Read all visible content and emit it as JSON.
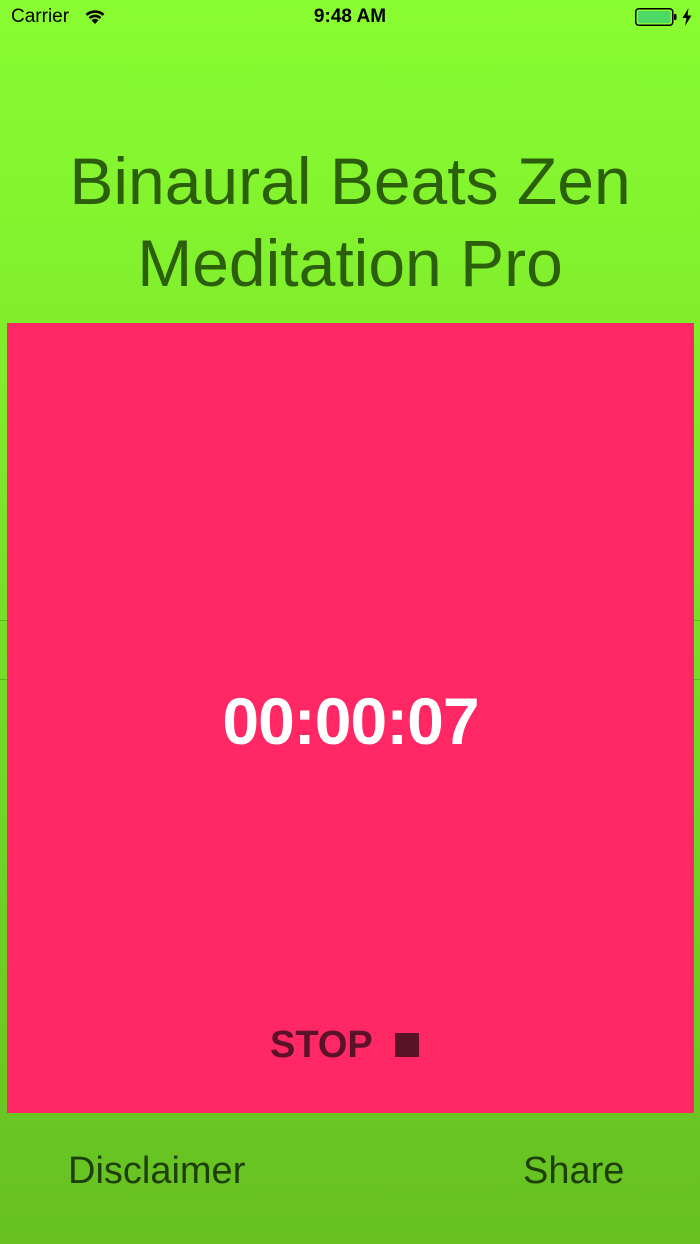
{
  "status_bar": {
    "carrier": "Carrier",
    "time": "9:48 AM",
    "wifi_icon": "wifi-icon",
    "battery_icon": "battery-full-icon",
    "charging_icon": "bolt-icon"
  },
  "app": {
    "title_line1": "Binaural Beats Zen",
    "title_line2": "Meditation Pro"
  },
  "timer": {
    "elapsed": "00:00:07",
    "stop_label": "STOP",
    "stop_icon": "stop-square-icon"
  },
  "footer": {
    "disclaimer_label": "Disclaimer",
    "share_label": "Share"
  },
  "colors": {
    "background": "#88fd31",
    "panel": "#ff2764",
    "title_text": "#2c5f0b",
    "stop_text": "#5a1229",
    "timer_text": "#ffffff"
  }
}
